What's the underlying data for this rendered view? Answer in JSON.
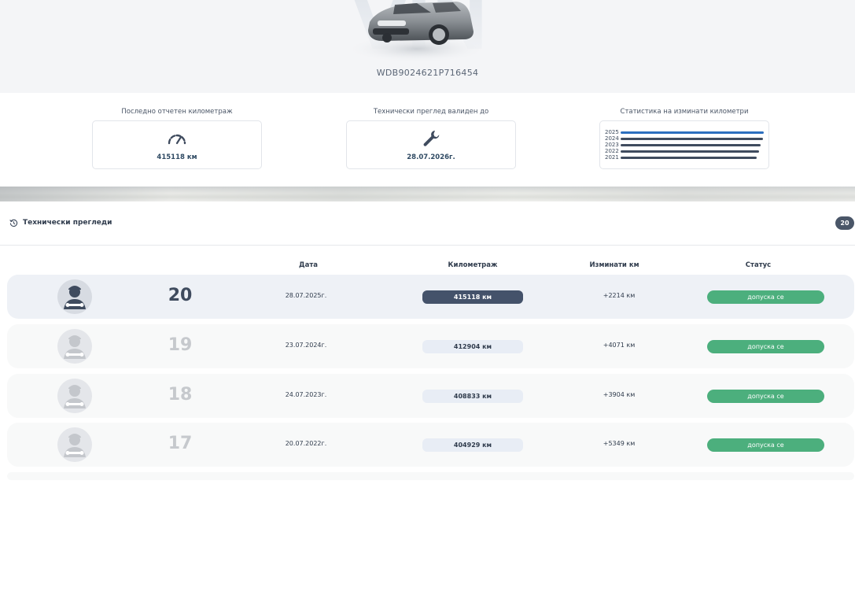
{
  "vehicle": {
    "vin": "WDB9024621P716454",
    "watermark": "VIN"
  },
  "stats": {
    "mileage": {
      "label": "Последно отчетен километраж",
      "value": "415118 км",
      "icon": "speedometer-icon"
    },
    "inspection": {
      "label": "Технически преглед валиден до",
      "value": "28.07.2026г.",
      "icon": "wrench-icon"
    },
    "chart": {
      "label": "Статистика на изминати километри",
      "chart_data": {
        "type": "bar",
        "orientation": "horizontal",
        "categories": [
          "2025",
          "2024",
          "2023",
          "2022",
          "2021"
        ],
        "colors": [
          "#2c6fbf",
          "#3f4b5e",
          "#3f4b5e",
          "#3f4b5e",
          "#3f4b5e"
        ],
        "values": [
          415118,
          412904,
          408833,
          404929,
          399580
        ]
      }
    }
  },
  "section": {
    "title": "Технически прегледи",
    "icon": "history-icon",
    "count": "20"
  },
  "table": {
    "columns": {
      "date": "Дата",
      "km": "Километраж",
      "delta": "Изминати км",
      "status": "Статус"
    },
    "rows": [
      {
        "num": "20",
        "date": "28.07.2025г.",
        "km": "415118 км",
        "delta": "+2214 км",
        "status": "допуска се"
      },
      {
        "num": "19",
        "date": "23.07.2024г.",
        "km": "412904 км",
        "delta": "+4071 км",
        "status": "допуска се"
      },
      {
        "num": "18",
        "date": "24.07.2023г.",
        "km": "408833 км",
        "delta": "+3904 км",
        "status": "допуска се"
      },
      {
        "num": "17",
        "date": "20.07.2022г.",
        "km": "404929 км",
        "delta": "+5349 км",
        "status": "допуска се"
      }
    ]
  },
  "colors": {
    "accent_dark": "#44526a",
    "status_ok": "#4caf7d",
    "chart_highlight": "#2c6fbf"
  }
}
